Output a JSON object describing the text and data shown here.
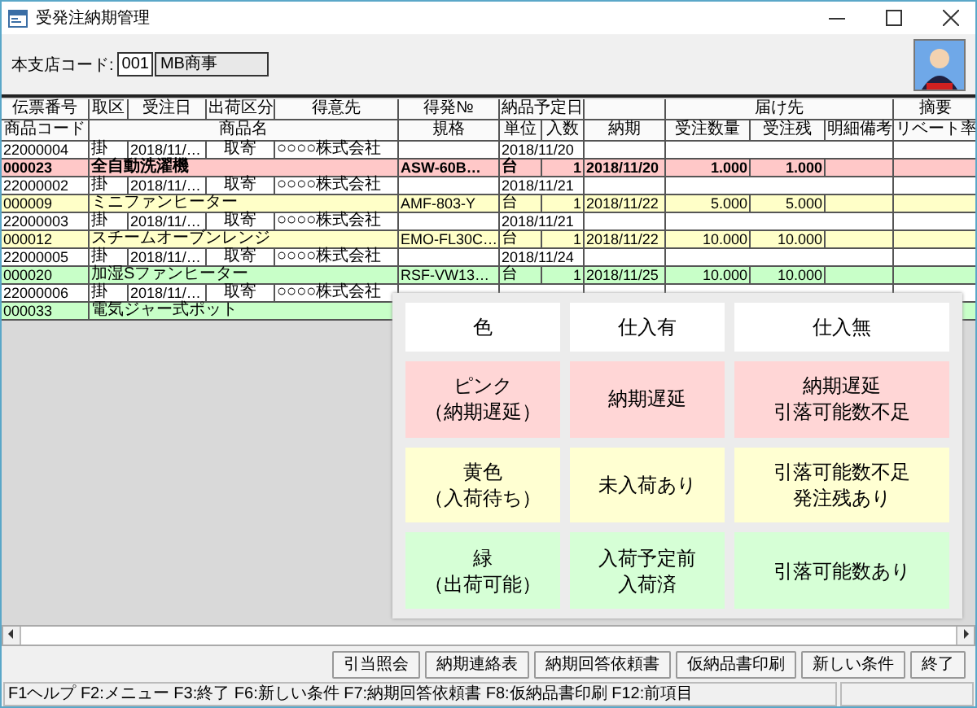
{
  "window": {
    "title": "受発注納期管理"
  },
  "branch": {
    "label": "本支店コード:",
    "code": "001",
    "name": "MB商事"
  },
  "table": {
    "header_row_1": [
      "伝票番号",
      "取区",
      "受注日",
      "出荷区分",
      "得意先",
      "得発№",
      "納品予定日",
      "届け先",
      "摘要"
    ],
    "header_row_2": [
      "商品コード",
      "商品名",
      "規格",
      "単位",
      "入数",
      "納期",
      "受注数量",
      "受注残",
      "明細備考",
      "リベート率"
    ],
    "rows": [
      {
        "slip_no": "22000004",
        "trade_type": "掛",
        "order_date": "2018/11/…",
        "shipping": "取寄",
        "customer": "○○○○株式会社",
        "delivery_date": "2018/11/20",
        "product_code": "000023",
        "product_name": "全自動洗濯機",
        "spec": "ASW-60B…",
        "unit": "台",
        "quantity_per": "1",
        "due_date": "2018/11/20",
        "order_qty": "1.000",
        "remaining": "1.000",
        "color": "#ffc8c8",
        "selected": true
      },
      {
        "slip_no": "22000002",
        "trade_type": "掛",
        "order_date": "2018/11/…",
        "shipping": "取寄",
        "customer": "○○○○株式会社",
        "delivery_date": "2018/11/21",
        "product_code": "000009",
        "product_name": "ミニファンヒーター",
        "spec": "AMF-803-Y",
        "unit": "台",
        "quantity_per": "1",
        "due_date": "2018/11/22",
        "order_qty": "5.000",
        "remaining": "5.000",
        "color": "#ffffc8",
        "selected": false
      },
      {
        "slip_no": "22000003",
        "trade_type": "掛",
        "order_date": "2018/11/…",
        "shipping": "取寄",
        "customer": "○○○○株式会社",
        "delivery_date": "2018/11/21",
        "product_code": "000012",
        "product_name": "スチームオーブンレンジ",
        "spec": "EMO-FL30C…",
        "unit": "台",
        "quantity_per": "1",
        "due_date": "2018/11/22",
        "order_qty": "10.000",
        "remaining": "10.000",
        "color": "#ffffc8",
        "selected": false
      },
      {
        "slip_no": "22000005",
        "trade_type": "掛",
        "order_date": "2018/11/…",
        "shipping": "取寄",
        "customer": "○○○○株式会社",
        "delivery_date": "2018/11/24",
        "product_code": "000020",
        "product_name": "加湿Sファンヒーター",
        "spec": "RSF-VW13…",
        "unit": "台",
        "quantity_per": "1",
        "due_date": "2018/11/25",
        "order_qty": "10.000",
        "remaining": "10.000",
        "color": "#c8ffc8",
        "selected": false
      },
      {
        "slip_no": "22000006",
        "trade_type": "掛",
        "order_date": "2018/11/…",
        "shipping": "取寄",
        "customer": "○○○○株式会社",
        "product_code": "000033",
        "product_name": "電気ジャー式ポット",
        "color": "#c8ffc8",
        "selected": false
      }
    ]
  },
  "legend": {
    "columns": [
      "色",
      "仕入有",
      "仕入無"
    ],
    "rows": [
      {
        "label": [
          "ピンク",
          "（納期遅延）"
        ],
        "with_purchase": [
          "納期遅延"
        ],
        "without_purchase": [
          "納期遅延",
          "引落可能数不足"
        ],
        "color": "#ffd6d6"
      },
      {
        "label": [
          "黄色",
          "（入荷待ち）"
        ],
        "with_purchase": [
          "未入荷あり"
        ],
        "without_purchase": [
          "引落可能数不足",
          "発注残あり"
        ],
        "color": "#ffffd2"
      },
      {
        "label": [
          "緑",
          "（出荷可能）"
        ],
        "with_purchase": [
          "入荷予定前",
          "入荷済"
        ],
        "without_purchase": [
          "引落可能数あり"
        ],
        "color": "#d6ffd6"
      }
    ]
  },
  "buttons": [
    "引当照会",
    "納期連絡表",
    "納期回答依頼書",
    "仮納品書印刷",
    "新しい条件",
    "終了"
  ],
  "status_bar": {
    "text": "F1ヘルプ F2:メニュー F3:終了 F6:新しい条件 F7:納期回答依頼書 F8:仮納品書印刷 F12:前項目"
  }
}
